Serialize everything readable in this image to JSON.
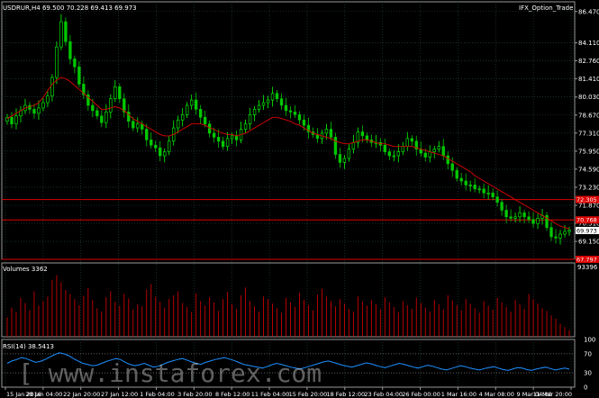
{
  "header": {
    "symbol_info": "USDRUR,H4  69.500 70.228 69.413 69.973",
    "indicator_name": "IFX_Option_Trade"
  },
  "volume_panel": {
    "label": "Volumes 3362",
    "scale_top": "93396"
  },
  "rsi_panel": {
    "label": "RSI(14) 38.5413",
    "levels": [
      "100",
      "70",
      "30",
      "0"
    ]
  },
  "watermark": "[ www.instaforex.com",
  "price_axis": {
    "ticks": [
      "86.470",
      "84.110",
      "82.760",
      "81.410",
      "80.030",
      "78.670",
      "77.310",
      "75.950",
      "74.590",
      "73.230",
      "71.870",
      "70.510",
      "69.150"
    ],
    "markers": [
      {
        "value": "72.305",
        "color": "#dd0000"
      },
      {
        "value": "70.768",
        "color": "#dd0000"
      },
      {
        "value": "69.973",
        "color": "#ffffff"
      },
      {
        "value": "67.797",
        "color": "#dd0000"
      }
    ]
  },
  "time_axis": [
    "15 Jan 2016",
    "20 Jan 04:00",
    "22 Jan 20:00",
    "27 Jan 12:00",
    "1 Feb 04:00",
    "3 Feb 20:00",
    "8 Feb 12:00",
    "11 Feb 04:00",
    "15 Feb 20:00",
    "18 Feb 12:00",
    "23 Feb 04:00",
    "26 Feb 00:00",
    "1 Mar 16:00",
    "4 Mar 08:00",
    "9 Mar 04:00",
    "11 Mar 20:00"
  ],
  "colors": {
    "bull": "#00ff00",
    "bear": "#00c800",
    "ma": "#dd0000",
    "rsi": "#1e90ff",
    "volume": "#cc0000",
    "grid": "#2a4a4a"
  },
  "chart_data": {
    "type": "candlestick",
    "price_range": [
      67.8,
      87.2
    ],
    "close_series": [
      78.5,
      78.0,
      78.6,
      79.0,
      79.4,
      79.1,
      78.8,
      79.2,
      79.6,
      80.1,
      81.5,
      83.8,
      85.7,
      84.2,
      82.9,
      82.3,
      81.0,
      80.2,
      79.4,
      79.0,
      78.6,
      78.1,
      78.9,
      79.9,
      80.8,
      79.9,
      78.9,
      78.2,
      77.7,
      78.0,
      77.6,
      76.8,
      76.4,
      76.2,
      75.6,
      75.9,
      76.7,
      77.7,
      78.3,
      78.7,
      79.4,
      79.8,
      79.1,
      78.5,
      78.0,
      77.3,
      77.0,
      76.7,
      76.3,
      76.9,
      77.1,
      76.8,
      77.6,
      78.0,
      78.7,
      79.1,
      79.4,
      79.6,
      79.8,
      80.3,
      79.9,
      79.4,
      79.0,
      78.9,
      78.7,
      78.3,
      77.9,
      77.4,
      77.2,
      76.9,
      77.3,
      77.6,
      77.0,
      75.7,
      75.1,
      75.4,
      76.1,
      76.6,
      77.4,
      77.1,
      76.8,
      76.6,
      76.6,
      76.4,
      75.9,
      75.6,
      75.6,
      75.9,
      76.3,
      76.9,
      76.7,
      76.1,
      75.8,
      75.5,
      75.9,
      76.1,
      76.3,
      75.6,
      75.0,
      74.5,
      73.9,
      73.7,
      73.4,
      73.4,
      73.1,
      73.1,
      72.8,
      72.8,
      72.5,
      72.1,
      71.5,
      71.0,
      70.9,
      71.0,
      71.3,
      71.0,
      70.8,
      70.5,
      70.9,
      71.1,
      70.2,
      69.5,
      69.4,
      69.7,
      69.9,
      70.0
    ],
    "ma_series": [
      78.4,
      78.6,
      78.8,
      79.0,
      79.2,
      79.3,
      79.4,
      79.6,
      80.0,
      80.5,
      81.0,
      81.3,
      81.5,
      81.4,
      81.2,
      80.9,
      80.6,
      80.3,
      80.0,
      79.7,
      79.4,
      79.1,
      79.1,
      79.2,
      79.3,
      79.2,
      79.0,
      78.7,
      78.4,
      78.2,
      78.0,
      77.8,
      77.6,
      77.4,
      77.2,
      77.1,
      77.1,
      77.2,
      77.4,
      77.6,
      77.8,
      78.0,
      78.0,
      78.0,
      77.9,
      77.7,
      77.6,
      77.4,
      77.3,
      77.2,
      77.2,
      77.1,
      77.2,
      77.3,
      77.5,
      77.7,
      77.9,
      78.1,
      78.3,
      78.5,
      78.5,
      78.4,
      78.3,
      78.2,
      78.0,
      77.9,
      77.7,
      77.5,
      77.3,
      77.2,
      77.1,
      77.0,
      76.9,
      76.7,
      76.6,
      76.5,
      76.5,
      76.6,
      76.7,
      76.8,
      76.8,
      76.7,
      76.6,
      76.5,
      76.5,
      76.4,
      76.3,
      76.3,
      76.3,
      76.3,
      76.3,
      76.2,
      76.1,
      76.0,
      75.9,
      75.8,
      75.7,
      75.6,
      75.4,
      75.2,
      75.0,
      74.8,
      74.6,
      74.4,
      74.1,
      73.9,
      73.7,
      73.5,
      73.3,
      73.1,
      72.9,
      72.7,
      72.5,
      72.3,
      72.1,
      71.9,
      71.7,
      71.5,
      71.3,
      71.1,
      70.9,
      70.7,
      70.5,
      70.3,
      70.2,
      70.1
    ],
    "volume_series": [
      30,
      45,
      38,
      60,
      52,
      41,
      70,
      48,
      55,
      62,
      88,
      95,
      84,
      72,
      66,
      58,
      49,
      63,
      75,
      57,
      44,
      39,
      61,
      70,
      54,
      48,
      66,
      59,
      42,
      50,
      47,
      73,
      81,
      62,
      54,
      45,
      58,
      64,
      70,
      52,
      46,
      38,
      67,
      55,
      48,
      61,
      53,
      40,
      58,
      69,
      50,
      43,
      64,
      76,
      55,
      47,
      39,
      62,
      58,
      51,
      44,
      37,
      60,
      53,
      46,
      68,
      57,
      49,
      41,
      65,
      74,
      62,
      55,
      47,
      58,
      51,
      43,
      39,
      62,
      54,
      48,
      57,
      50,
      42,
      61,
      53,
      46,
      38,
      55,
      49,
      43,
      60,
      52,
      45,
      39,
      57,
      50,
      42,
      64,
      56,
      49,
      41,
      58,
      51,
      44,
      37,
      55,
      48,
      42,
      60,
      53,
      46,
      39,
      57,
      50,
      43,
      66,
      58,
      51,
      44,
      40,
      33,
      28,
      20,
      15,
      10
    ],
    "rsi_series": [
      50,
      55,
      58,
      62,
      60,
      56,
      52,
      54,
      58,
      63,
      68,
      72,
      70,
      66,
      60,
      55,
      50,
      48,
      45,
      46,
      50,
      54,
      57,
      60,
      58,
      52,
      48,
      45,
      47,
      50,
      46,
      42,
      44,
      48,
      52,
      55,
      58,
      60,
      57,
      53,
      50,
      48,
      52,
      55,
      58,
      60,
      62,
      59,
      56,
      52,
      48,
      46,
      44,
      42,
      40,
      43,
      47,
      50,
      48,
      45,
      42,
      40,
      38,
      41,
      44,
      47,
      50,
      53,
      55,
      52,
      49,
      46,
      44,
      42,
      45,
      48,
      51,
      49,
      46,
      43,
      41,
      44,
      47,
      50,
      48,
      45,
      42,
      40,
      43,
      46,
      44,
      41,
      38,
      36,
      39,
      42,
      45,
      43,
      40,
      38,
      36,
      39,
      41,
      43,
      40,
      37,
      35,
      38,
      41,
      40,
      37,
      35,
      38,
      40,
      42,
      39,
      36,
      38,
      40,
      38
    ],
    "levels": {
      "upper": 72.305,
      "middle": 70.768,
      "lower": 67.797,
      "last": 69.973
    },
    "rsi_levels": [
      70,
      30
    ]
  }
}
